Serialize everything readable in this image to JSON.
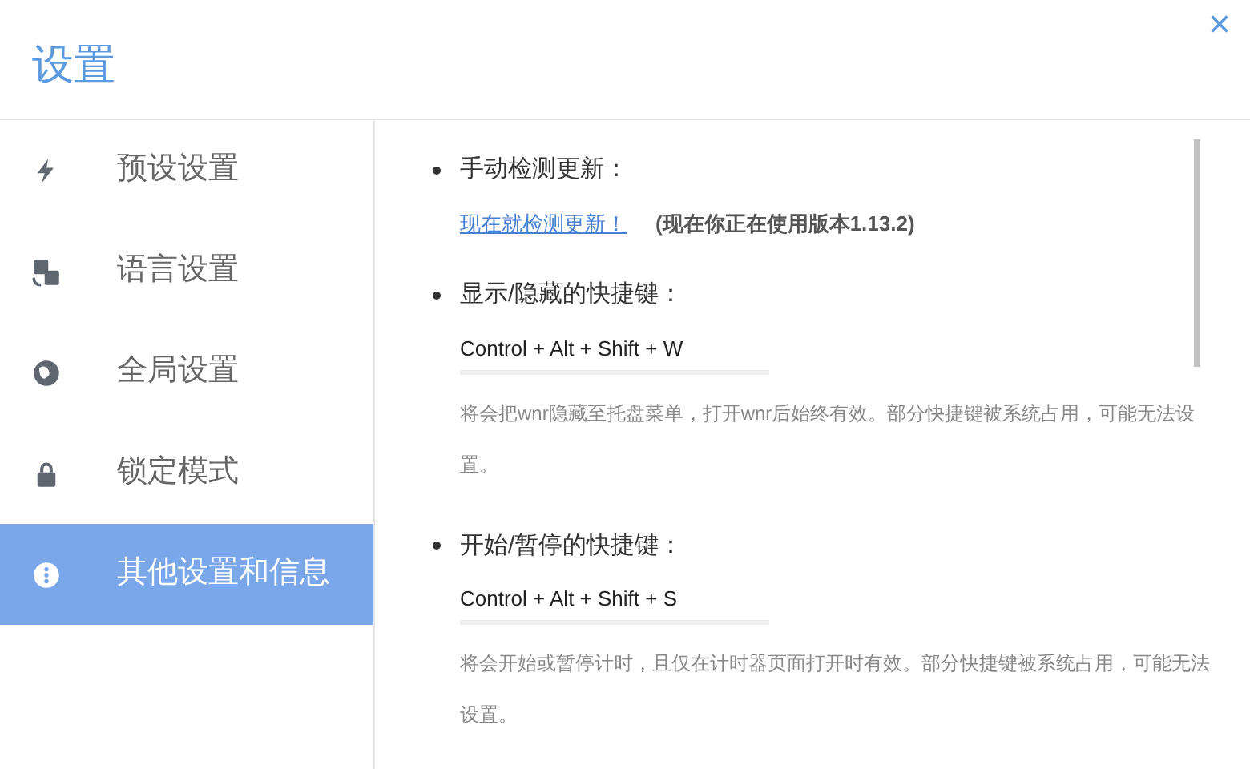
{
  "window": {
    "title": "设置",
    "close": "×"
  },
  "sidebar": {
    "items": [
      {
        "label": "预设设置",
        "selected": false
      },
      {
        "label": "语言设置",
        "selected": false
      },
      {
        "label": "全局设置",
        "selected": false
      },
      {
        "label": "锁定模式",
        "selected": false
      },
      {
        "label": "其他设置和信息",
        "selected": true
      }
    ]
  },
  "sections": [
    {
      "kind": "update",
      "heading": "手动检测更新：",
      "link": "现在就检测更新！",
      "note": "(现在你正在使用版本1.13.2)"
    },
    {
      "kind": "hotkey",
      "heading": "显示/隐藏的快捷键：",
      "value": "Control + Alt + Shift + W",
      "description": "将会把wnr隐藏至托盘菜单，打开wnr后始终有效。部分快捷键被系统占用，可能无法设置。"
    },
    {
      "kind": "hotkey",
      "heading": "开始/暂停的快捷键：",
      "value": "Control + Alt + Shift + S",
      "description": "将会开始或暂停计时，且仅在计时器页面打开时有效。部分快捷键被系统占用，可能无法设置。"
    }
  ]
}
